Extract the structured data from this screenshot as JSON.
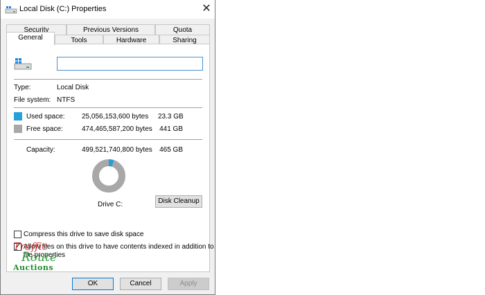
{
  "window": {
    "title": "Local Disk (C:) Properties",
    "close_glyph": "✕"
  },
  "tabs_row1": [
    {
      "label": "Security"
    },
    {
      "label": "Previous Versions"
    },
    {
      "label": "Quota"
    }
  ],
  "tabs_row2": [
    {
      "label": "General",
      "active": true
    },
    {
      "label": "Tools"
    },
    {
      "label": "Hardware"
    },
    {
      "label": "Sharing"
    }
  ],
  "general": {
    "name_value": "",
    "type_label": "Type:",
    "type_value": "Local Disk",
    "fs_label": "File system:",
    "fs_value": "NTFS",
    "used": {
      "label": "Used space:",
      "bytes": "25,056,153,600 bytes",
      "size": "23.3 GB",
      "color": "#26a0da"
    },
    "free": {
      "label": "Free space:",
      "bytes": "474,465,587,200 bytes",
      "size": "441 GB",
      "color": "#a8a8a8"
    },
    "capacity": {
      "label": "Capacity:",
      "bytes": "499,521,740,800 bytes",
      "size": "465 GB"
    },
    "used_fraction": 0.0502,
    "drive_label": "Drive C:",
    "cleanup_button": "Disk Cleanup",
    "compress_label": "Compress this drive to save disk space",
    "compress_checked": false,
    "index_label_line1": "Allow files on this drive to have contents indexed in addition to",
    "index_label_line2": "file properties",
    "index_checked": true
  },
  "buttons": {
    "ok": "OK",
    "cancel": "Cancel",
    "apply": "Apply"
  },
  "watermark": {
    "line1": "Traffic",
    "line2": "Route",
    "line3": "Auctions"
  }
}
